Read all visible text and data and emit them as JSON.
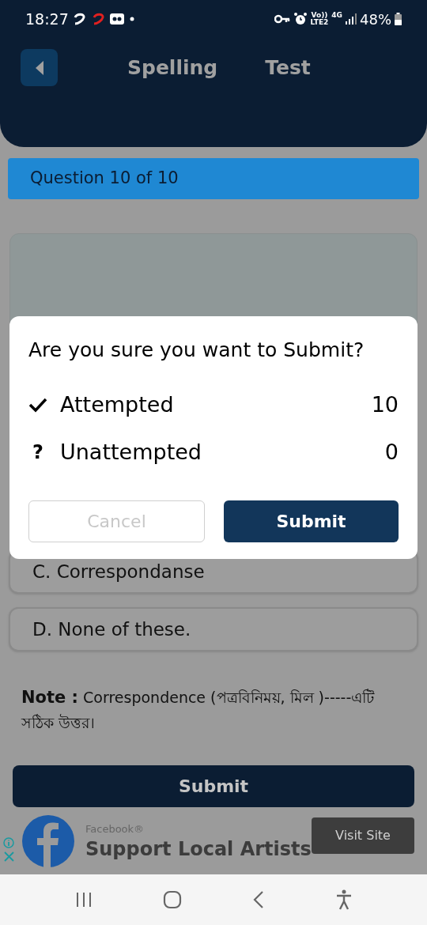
{
  "status_bar": {
    "time": "18:27",
    "network": [
      "Vo))",
      "LTE2",
      "4G"
    ],
    "battery": "48%"
  },
  "header": {
    "title_words": [
      "Spelling",
      "Test"
    ]
  },
  "question_bar": {
    "label": "Question 10 of 10"
  },
  "options": [
    {
      "text": "C. Correspondanse"
    },
    {
      "text": "D. None of these."
    }
  ],
  "note": {
    "label": "Note :",
    "text": "Correspondence (পত্রবিনিময়, মিল )-----এটি সঠিক উত্তর।"
  },
  "submit_button": {
    "label": "Submit"
  },
  "ad": {
    "advertiser": "Facebook®",
    "headline": "Support Local Artists",
    "cta": "Visit Site"
  },
  "dialog": {
    "title": "Are you sure you want to Submit?",
    "rows": [
      {
        "kind": "attempted",
        "label": "Attempted",
        "count": "10"
      },
      {
        "kind": "unattempted",
        "symbol": "?",
        "label": "Unattempted",
        "count": "0"
      }
    ],
    "cancel": {
      "label": "Cancel",
      "disabled": true
    },
    "submit": {
      "label": "Submit"
    }
  }
}
